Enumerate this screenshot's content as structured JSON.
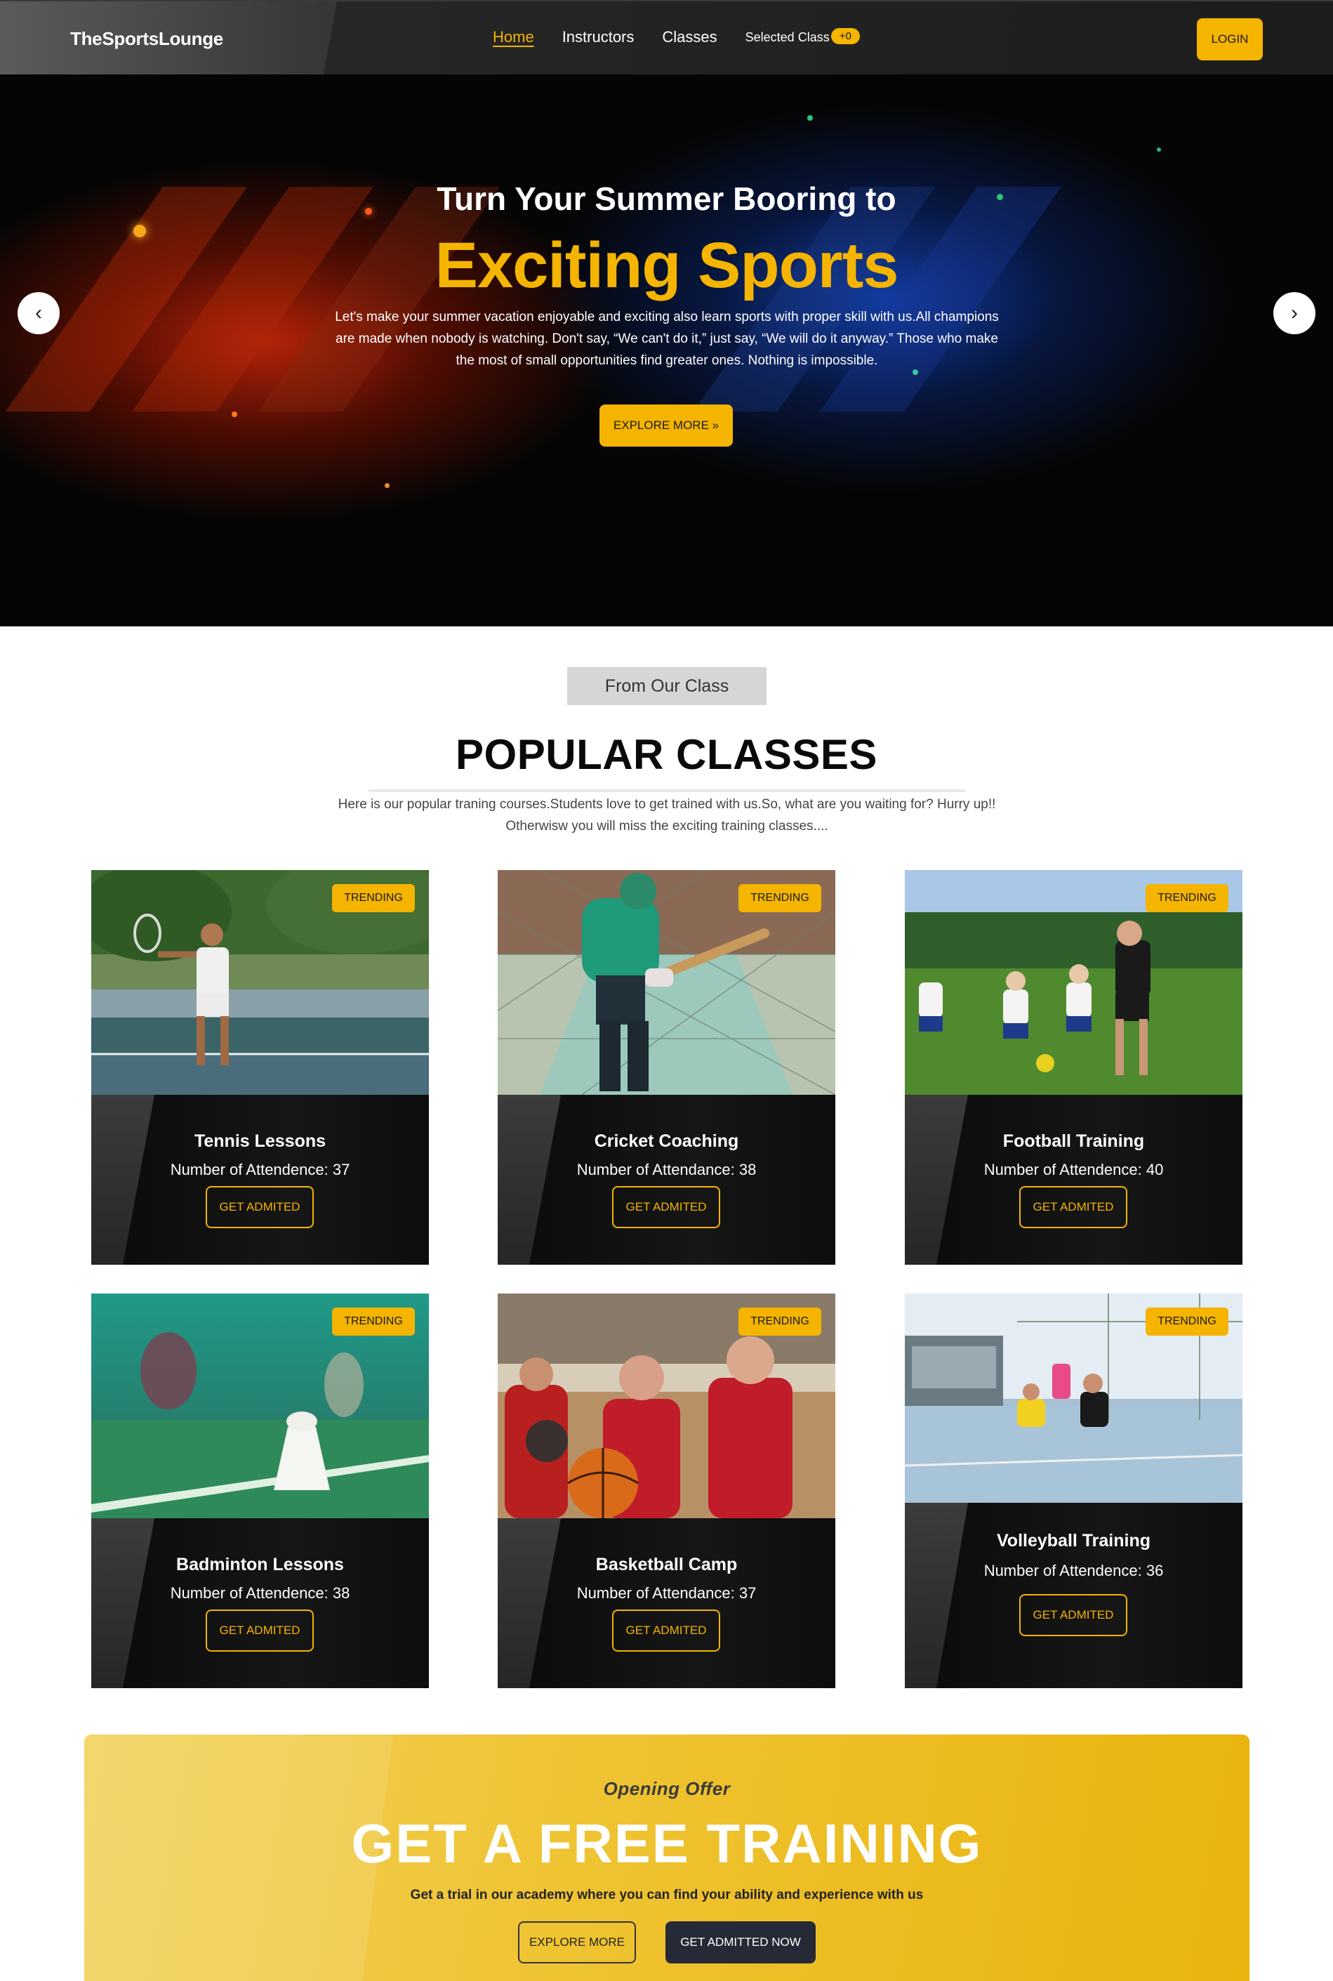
{
  "nav": {
    "brand": "TheSportsLounge",
    "links": [
      "Home",
      "Instructors",
      "Classes"
    ],
    "selected_label": "Selected Class",
    "selected_count": "+0",
    "login": "LOGIN"
  },
  "hero": {
    "subtitle": "Turn Your Summer Booring to",
    "title": "Exciting Sports",
    "text": "Let's make your summer vacation enjoyable and exciting also learn sports with proper skill with us.All champions are made when nobody is watching. Don't say, “We can't do it,” just say, “We will do it anyway.” Those who make the most of small opportunities find greater ones. Nothing is impossible.",
    "button": "EXPLORE MORE »",
    "prev_icon": "‹",
    "next_icon": "›"
  },
  "popular": {
    "tag": "From Our Class",
    "title": "POPULAR CLASSES",
    "description": "Here is our popular traning courses.Students love to get trained with us.So, what are you waiting for? Hurry up!! Otherwisw you will miss the exciting training classes....",
    "badge": "TRENDING",
    "admit_label": "GET ADMITED",
    "classes": [
      {
        "name": "Tennis Lessons",
        "attendance": "Number of Attendence: 37",
        "image": "tennis-player"
      },
      {
        "name": "Cricket Coaching",
        "attendance": "Number of Attendance: 38",
        "image": "cricket-batsman"
      },
      {
        "name": "Football Training",
        "attendance": "Number of Attendence: 40",
        "image": "football-kids"
      },
      {
        "name": "Badminton Lessons",
        "attendance": "Number of Attendence: 38",
        "image": "badminton-shuttlecock"
      },
      {
        "name": "Basketball Camp",
        "attendance": "Number of Attendance: 37",
        "image": "basketball-girls"
      },
      {
        "name": "Volleyball Training",
        "attendance": "Number of Attendence: 36",
        "image": "volleyball-court"
      }
    ]
  },
  "offer": {
    "kicker": "Opening Offer",
    "title": "GET A FREE TRAINING",
    "text": "Get a trial in our academy where you can find your ability and experience with us",
    "explore": "EXPLORE MORE",
    "admit": "GET ADMITTED NOW"
  },
  "colors": {
    "accent": "#f4b400",
    "dark": "#111111",
    "button_dark": "#262a36"
  }
}
